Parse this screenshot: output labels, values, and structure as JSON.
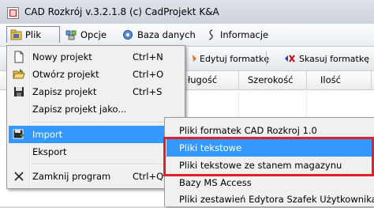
{
  "window": {
    "title": "CAD Rozkrój v.3.2.1.8  (c) CadProjekt K&A"
  },
  "menubar": {
    "items": [
      {
        "label": "Plik",
        "icon": "folder-icon"
      },
      {
        "label": "Opcje",
        "icon": "settings-icon"
      },
      {
        "label": "Baza danych",
        "icon": "database-icon"
      },
      {
        "label": "Informacje",
        "icon": "info-icon"
      }
    ]
  },
  "toolbar": {
    "edit_label": "Edytuj formatkę",
    "delete_label": "Skasuj formatkę"
  },
  "grid": {
    "columns": [
      "ługość",
      "Szerokość",
      "Ilość"
    ]
  },
  "file_menu": {
    "items": [
      {
        "label": "Nowy projekt",
        "shortcut": "Ctrl+N",
        "icon": "new-document-icon"
      },
      {
        "label": "Otwórz projekt",
        "shortcut": "Ctrl+O",
        "icon": "open-folder-icon"
      },
      {
        "label": "Zapisz projekt",
        "shortcut": "Ctrl+S",
        "icon": "save-icon"
      },
      {
        "label": "Zapisz projekt jako...",
        "shortcut": ""
      },
      {
        "label": "Import",
        "shortcut": "",
        "icon": "import-icon",
        "submenu": true
      },
      {
        "label": "Eksport",
        "shortcut": "",
        "submenu": true
      },
      {
        "label": "Zamknij program",
        "shortcut": "Ctrl+Q",
        "icon": "close-icon"
      }
    ]
  },
  "import_submenu": {
    "items": [
      {
        "label": "Pliki formatek CAD Rozkroj 1.0"
      },
      {
        "label": "Pliki tekstowe"
      },
      {
        "label": "Pliki tekstowe ze stanem magazynu"
      },
      {
        "label": "Bazy MS Access"
      },
      {
        "label": "Pliki zestawień Edytora Szafek Użytkownika"
      }
    ]
  },
  "colors": {
    "highlight": "#3399ff",
    "annotation_box": "#e0202a"
  }
}
